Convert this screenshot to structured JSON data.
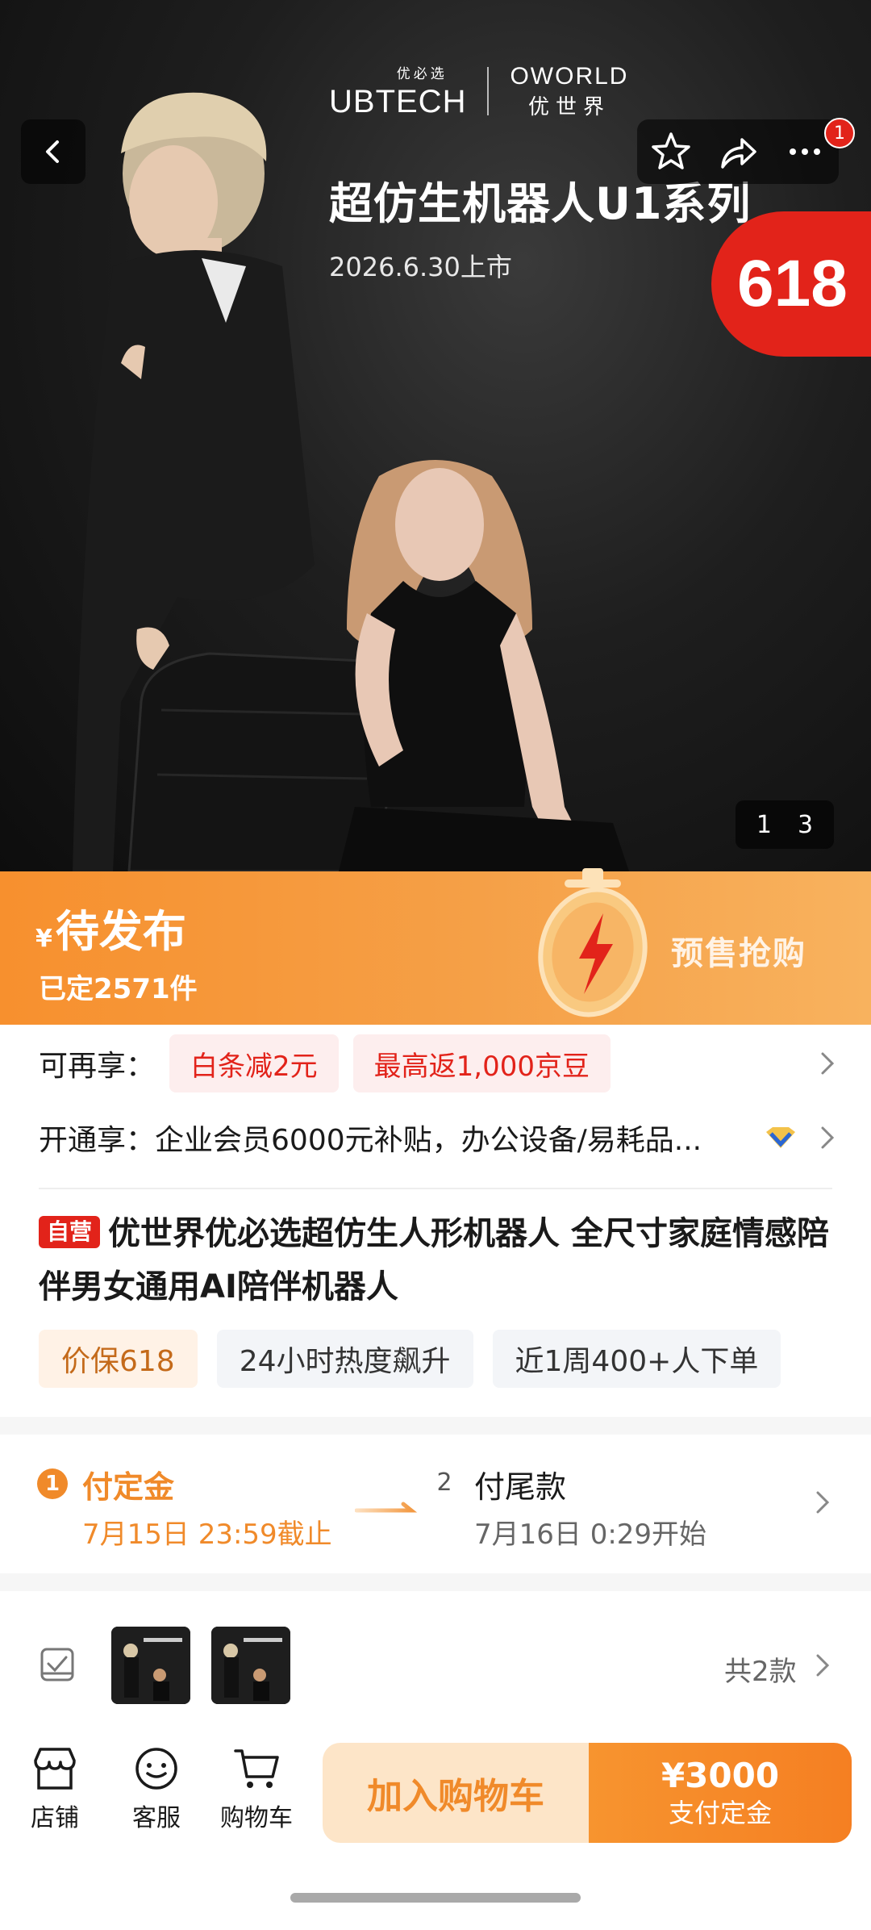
{
  "hero": {
    "brand_ub_small": "优必选",
    "brand_ub": "UBTECH",
    "brand_ow": "OWORLD",
    "brand_ow_small": "优世界",
    "title": "超仿生机器人U1系列",
    "launch_date": "2026.6.30上市",
    "promo_badge": "618",
    "notification_count": "1",
    "page_current": "1",
    "page_total": "3"
  },
  "price": {
    "currency": "¥",
    "status": "待发布",
    "booked": "已定2571件",
    "presale_label": "预售抢购"
  },
  "benefits": {
    "extra_label": "可再享：",
    "extra_tags": [
      "白条减2元",
      "最高返1,000京豆"
    ],
    "open_label": "开通享：",
    "open_desc": "企业会员6000元补贴，办公设备/易耗品..."
  },
  "product": {
    "self_badge": "自营",
    "title": "优世界优必选超仿生人形机器人 全尺寸家庭情感陪伴男女通用AI陪伴机器人",
    "tags": [
      "价保618",
      "24小时热度飙升",
      "近1周400+人下单"
    ]
  },
  "payment_steps": [
    {
      "num": "1",
      "title": "付定金",
      "time": "7月15日 23:59截止"
    },
    {
      "num": "2",
      "title": "付尾款",
      "time": "7月16日 0:29开始"
    }
  ],
  "variants": {
    "count_label": "共2款"
  },
  "bottom_nav": {
    "items": [
      {
        "label": "店铺",
        "icon": "store-icon"
      },
      {
        "label": "客服",
        "icon": "customer-service-icon"
      },
      {
        "label": "购物车",
        "icon": "cart-icon"
      }
    ],
    "add_to_cart": "加入购物车",
    "pay_amount": "¥3000",
    "pay_label": "支付定金"
  },
  "colors": {
    "accent_orange": "#f08a2a",
    "promo_red": "#e2231a",
    "hero_bg": "#1e1e1e"
  }
}
